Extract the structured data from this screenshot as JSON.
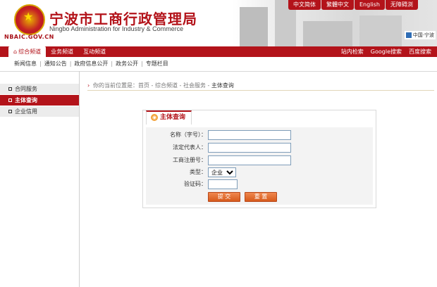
{
  "header": {
    "site_name_cn": "宁波市工商行政管理局",
    "site_name_en": "Ningbo Administration for Industry & Commerce",
    "domain": "NBAIC.GOV.CN",
    "emblem_icon": "national-emblem-icon",
    "city_badge": "中国·宁波",
    "lang_links": [
      "中文简体",
      "繁體中文",
      "English",
      "无障碍浏"
    ]
  },
  "nav_main": {
    "tabs": [
      "综合频道",
      "业务频道",
      "互动频道"
    ],
    "active_index": 0,
    "home_icon": "home-icon",
    "right_links": [
      "站内检索",
      "Google搜索",
      "百度搜索"
    ]
  },
  "nav_sub": {
    "items": [
      "新闻信息",
      "通知公告",
      "政府信息公开",
      "政务公开",
      "专题栏目"
    ]
  },
  "sidebar": {
    "items": [
      "合同服务",
      "主体查询",
      "企业信用"
    ],
    "active_index": 1
  },
  "breadcrumb": {
    "prefix": "你的当前位置是：首页 - 综合频道 - 社会服务 - ",
    "current": "主体查询"
  },
  "panel": {
    "title": "主体查询",
    "fields": {
      "name_label": "名称（字号）：",
      "legal_rep_label": "法定代表人：",
      "reg_no_label": "工商注册号：",
      "type_label": "类型：",
      "type_value": "企业",
      "captcha_label": "验证码："
    },
    "submit_label": "提 交",
    "reset_label": "重 置"
  },
  "colors": {
    "brand_red": "#b3131a",
    "button_orange": "#e06a2a"
  }
}
